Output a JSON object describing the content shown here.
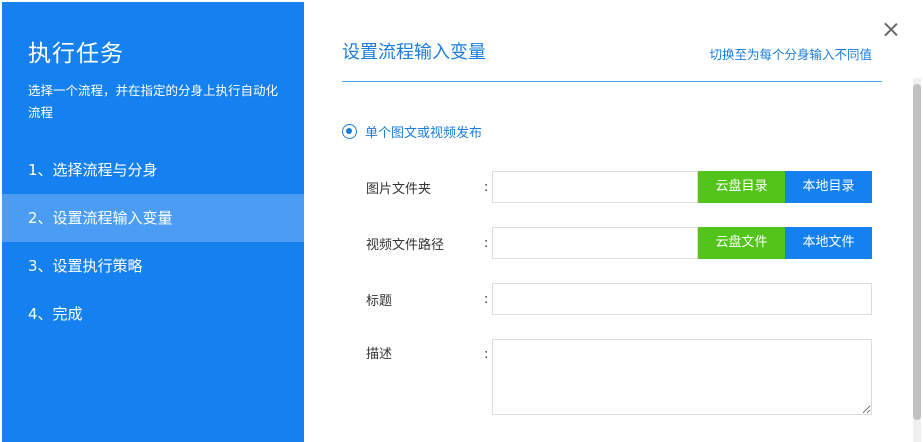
{
  "sidebar": {
    "title": "执行任务",
    "description": "选择一个流程，并在指定的分身上执行自动化流程",
    "steps": [
      {
        "label": "1、选择流程与分身"
      },
      {
        "label": "2、设置流程输入变量"
      },
      {
        "label": "3、设置执行策略"
      },
      {
        "label": "4、完成"
      }
    ],
    "active_step": 1
  },
  "header": {
    "title": "设置流程输入变量",
    "switch_link": "切换至为每个分身输入不同值"
  },
  "mode": {
    "label": "单个图文或视频发布",
    "selected": true
  },
  "form": {
    "image_folder": {
      "label": "图片文件夹",
      "colon": ":",
      "value": "",
      "btn_cloud": "云盘目录",
      "btn_local": "本地目录"
    },
    "video_path": {
      "label": "视频文件路径",
      "colon": ":",
      "value": "",
      "btn_cloud": "云盘文件",
      "btn_local": "本地文件"
    },
    "title": {
      "label": "标题",
      "colon": ":",
      "value": ""
    },
    "description": {
      "label": "描述",
      "colon": ":",
      "value": ""
    }
  },
  "colors": {
    "sidebar_bg": "#1580f0",
    "active_step_bg": "#4a9df3",
    "accent": "#1a7ddd",
    "green_button": "#52c41a",
    "blue_button": "#1580f0"
  }
}
